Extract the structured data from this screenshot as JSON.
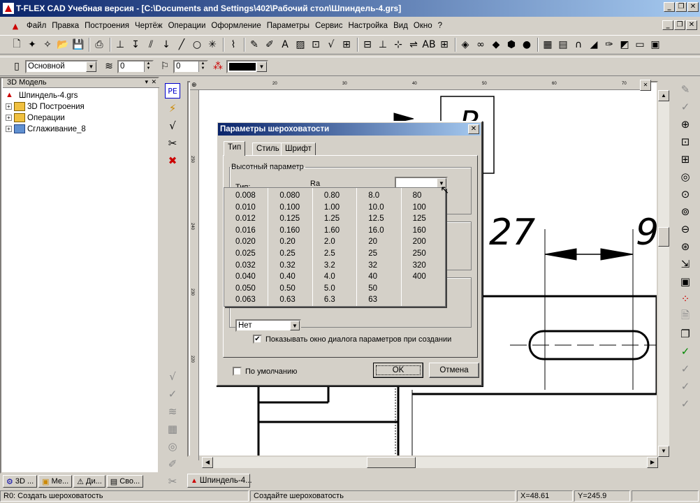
{
  "window": {
    "title": "T-FLEX CAD Учебная версия - [C:\\Documents and Settings\\402\\Рабочий стол\\Шпиндель-4.grs]"
  },
  "menu": [
    "Файл",
    "Правка",
    "Построения",
    "Чертёж",
    "Операции",
    "Оформление",
    "Параметры",
    "Сервис",
    "Настройка",
    "Вид",
    "Окно",
    "?"
  ],
  "props": {
    "layer": "Основной",
    "level": "0",
    "priority": "0",
    "color": "#000000"
  },
  "panel": {
    "title": "3D Модель",
    "root": "Шпиндель-4.grs",
    "items": [
      "3D Построения",
      "Операции",
      "Сглаживание_8"
    ]
  },
  "bottom_tabs": [
    "3D ...",
    "Ме...",
    "Ди...",
    "Сво..."
  ],
  "doc_tab": "Шпиндель-4...",
  "status": {
    "left": "R0: Создать шероховатость",
    "mid": "Создайте шероховатость",
    "x": "X=48.61",
    "y": "Y=245.9"
  },
  "ruler": {
    "top": [
      "20",
      "30",
      "40",
      "50",
      "60",
      "70"
    ],
    "left": [
      "250",
      "240",
      "230",
      "220"
    ]
  },
  "drawing": {
    "dim1": "27",
    "dim2": "9",
    "letter": "R"
  },
  "dialog": {
    "title": "Параметры шероховатости",
    "tabs": [
      "Тип",
      "Стиль",
      "Шрифт"
    ],
    "group_height": "Высотный параметр",
    "type_label": "Тип:",
    "param_label": "Ra",
    "select_value": "Нет",
    "show_dialog_label": "Показывать окно диалога параметров при создании",
    "default_label": "По умолчанию",
    "ok": "OK",
    "cancel": "Отмена",
    "values": [
      [
        "0.008",
        "0.010",
        "0.012",
        "0.016",
        "0.020",
        "0.025",
        "0.032",
        "0.040",
        "0.050",
        "0.063"
      ],
      [
        "0.080",
        "0.100",
        "0.125",
        "0.160",
        "0.20",
        "0.25",
        "0.32",
        "0.40",
        "0.50",
        "0.63"
      ],
      [
        "0.80",
        "1.00",
        "1.25",
        "1.60",
        "2.0",
        "2.5",
        "3.2",
        "4.0",
        "5.0",
        "6.3"
      ],
      [
        "8.0",
        "10.0",
        "12.5",
        "16.0",
        "20",
        "25",
        "32",
        "40",
        "50",
        "63"
      ],
      [
        "80",
        "100",
        "125",
        "160",
        "200",
        "250",
        "320",
        "400"
      ]
    ]
  }
}
